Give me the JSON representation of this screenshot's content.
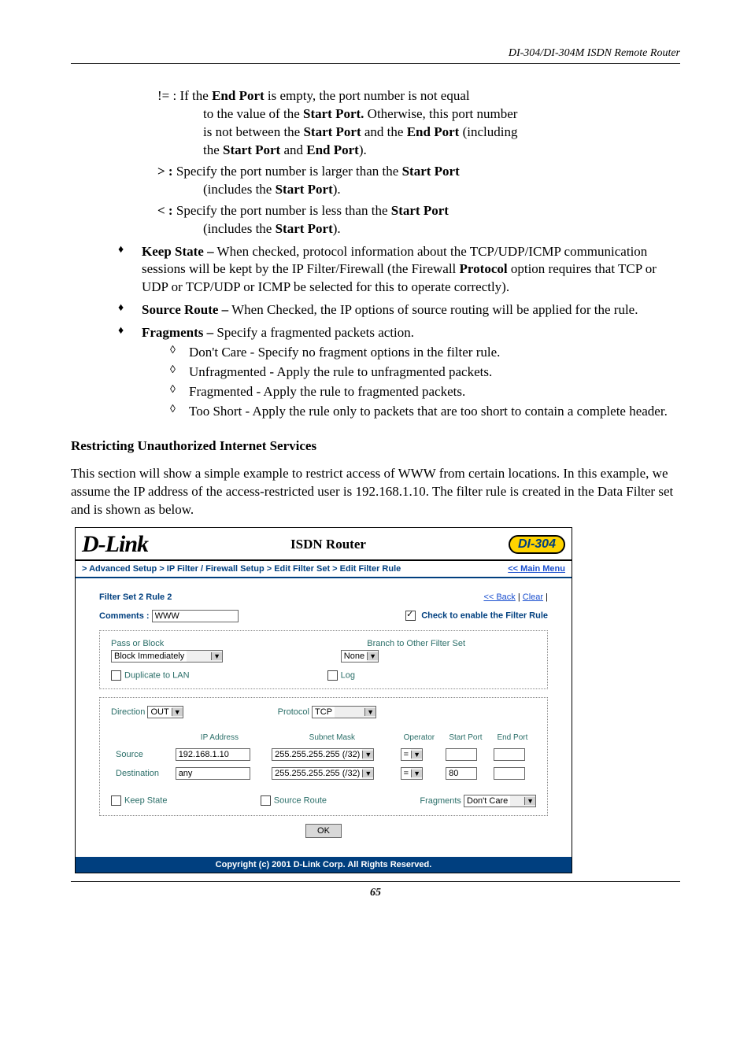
{
  "header": "DI-304/DI-304M ISDN Remote Router",
  "page_number": "65",
  "operators": {
    "neq_symbol": "!= :",
    "neq_text_1": "If the",
    "neq_bold_1": "End Port",
    "neq_text_2": "is empty, the port number is not equal",
    "neq_line2_a": "to the value of the",
    "neq_line2_b": "Start Port.",
    "neq_line2_c": "Otherwise, this port number",
    "neq_line3_a": "is not between the",
    "neq_line3_b": "Start Port",
    "neq_line3_c": "and the",
    "neq_line3_d": "End Port",
    "neq_line3_e": "(including",
    "neq_line4_a": "the",
    "neq_line4_b": "Start Port",
    "neq_line4_c": "and",
    "neq_line4_d": "End Port",
    "neq_line4_e": ").",
    "gt_symbol": "> :",
    "gt_text_a": "Specify the port number is larger than the",
    "gt_text_b": "Start Port",
    "gt_sub_a": "(includes the",
    "gt_sub_b": "Start Port",
    "gt_sub_c": ").",
    "lt_symbol": "< :",
    "lt_text_a": "Specify the port number is less than the",
    "lt_text_b": "Start Port",
    "lt_sub_a": "(includes the",
    "lt_sub_b": "Start Port",
    "lt_sub_c": ")."
  },
  "bullets": {
    "keep_state_title": "Keep State –",
    "keep_state_text": "When checked, protocol information about the TCP/UDP/ICMP communication sessions will be kept by the IP Filter/Firewall (the Firewall",
    "keep_state_bold": "Protocol",
    "keep_state_text2": "option requires that TCP or UDP or TCP/UDP or ICMP be selected for this to operate correctly).",
    "source_route_title": "Source Route –",
    "source_route_text": "When Checked, the IP options of source routing will be applied for the rule.",
    "fragments_title": "Fragments –",
    "fragments_text": "Specify a fragmented packets action.",
    "frag_sub1": "Don't Care - Specify no fragment options in the filter rule.",
    "frag_sub2": "Unfragmented - Apply the rule to unfragmented packets.",
    "frag_sub3": "Fragmented - Apply the rule to fragmented packets.",
    "frag_sub4": "Too Short - Apply the rule only to packets that are too short to contain a complete header."
  },
  "section_heading": "Restricting Unauthorized Internet Services",
  "paragraph": "This section will show a simple example to restrict access of WWW from certain locations. In this example, we assume the IP address of the access-restricted user is 192.168.1.10. The filter rule is created in the Data Filter set and is shown as below.",
  "router": {
    "brand": "D-Link",
    "title": "ISDN Router",
    "model": "DI-304",
    "breadcrumb": "> Advanced Setup > IP Filter / Firewall Setup > Edit Filter Set > Edit Filter Rule",
    "main_menu": "<< Main Menu",
    "rule_title": "Filter Set 2 Rule 2",
    "back": "<< Back",
    "clear": "Clear",
    "comments_label": "Comments :",
    "comments_value": "WWW",
    "enable_label": "Check to enable the Filter Rule",
    "enable_checked": true,
    "pass_or_block_label": "Pass or Block",
    "pass_or_block_value": "Block Immediately",
    "branch_label": "Branch to Other Filter Set",
    "branch_value": "None",
    "duplicate_label": "Duplicate to LAN",
    "log_label": "Log",
    "direction_label": "Direction",
    "direction_value": "OUT",
    "protocol_label": "Protocol",
    "protocol_value": "TCP",
    "col_ip": "IP Address",
    "col_mask": "Subnet Mask",
    "col_op": "Operator",
    "col_sport": "Start Port",
    "col_eport": "End Port",
    "row_source": "Source",
    "row_dest": "Destination",
    "source_ip": "192.168.1.10",
    "dest_ip": "any",
    "mask_value": "255.255.255.255 (/32)",
    "op_value": "=",
    "dest_sport": "80",
    "keep_state": "Keep State",
    "source_route": "Source Route",
    "fragments_label": "Fragments",
    "fragments_value": "Don't Care",
    "ok": "OK",
    "copyright": "Copyright (c) 2001 D-Link Corp. All Rights Reserved."
  }
}
